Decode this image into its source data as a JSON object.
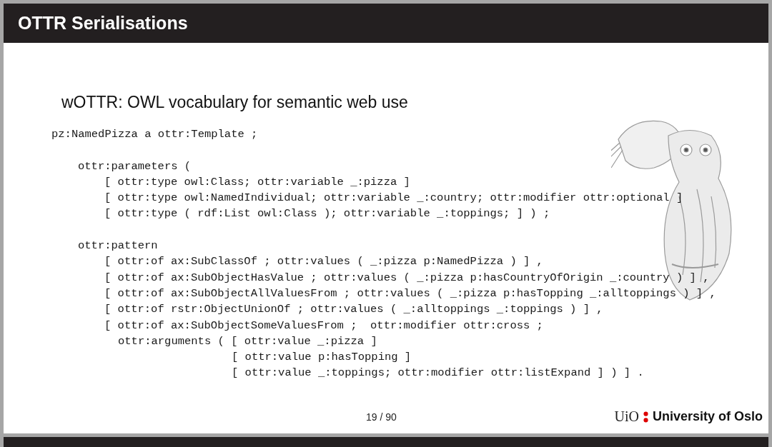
{
  "slide": {
    "title": "OTTR Serialisations",
    "subtitle": "wOTTR: OWL vocabulary for semantic web use",
    "code": [
      {
        "kind": "declaration",
        "text": "pz:NamedPizza a ottr:Template ;"
      },
      {
        "kind": "section",
        "text": "ottr:parameters ("
      },
      {
        "kind": "item",
        "text": "[ ottr:type owl:Class; ottr:variable _:pizza ]"
      },
      {
        "kind": "item",
        "text": "[ ottr:type owl:NamedIndividual; ottr:variable _:country; ottr:modifier ottr:optional ]"
      },
      {
        "kind": "item",
        "text": "[ ottr:type ( rdf:List owl:Class ); ottr:variable _:toppings; ] ) ;"
      },
      {
        "kind": "section",
        "text": "ottr:pattern"
      },
      {
        "kind": "item",
        "text": "[ ottr:of ax:SubClassOf ; ottr:values ( _:pizza p:NamedPizza ) ] ,"
      },
      {
        "kind": "item",
        "text": "[ ottr:of ax:SubObjectHasValue ; ottr:values ( _:pizza p:hasCountryOfOrigin _:country ) ] ,"
      },
      {
        "kind": "item",
        "text": "[ ottr:of ax:SubObjectAllValuesFrom ; ottr:values ( _:pizza p:hasTopping _:alltoppings ) ] ,"
      },
      {
        "kind": "item",
        "text": "[ ottr:of rstr:ObjectUnionOf ; ottr:values ( _:alltoppings _:toppings ) ] ,"
      },
      {
        "kind": "item",
        "text": "[ ottr:of ax:SubObjectSomeValuesFrom ;  ottr:modifier ottr:cross ;"
      },
      {
        "kind": "arguments",
        "text": "ottr:arguments ( [ ottr:value _:pizza ]"
      },
      {
        "kind": "continuation",
        "text": "[ ottr:value p:hasTopping ]"
      },
      {
        "kind": "continuation",
        "text": "[ ottr:value _:toppings; ottr:modifier ottr:listExpand ] ) ] ."
      }
    ],
    "page_number": "19 / 90",
    "logo": {
      "short": "UiO",
      "name": "University of Oslo"
    }
  }
}
